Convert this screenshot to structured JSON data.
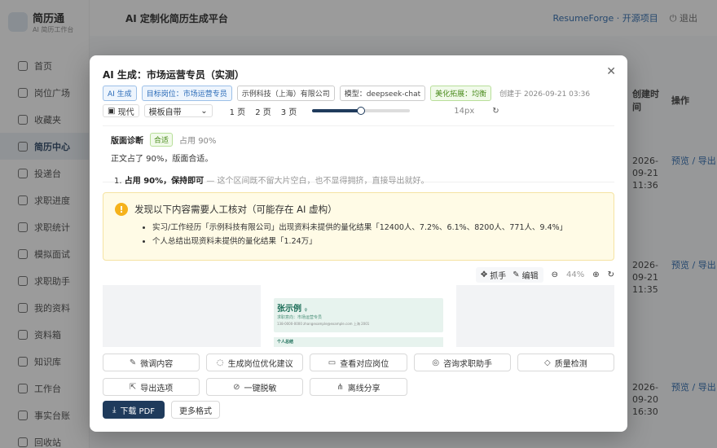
{
  "app": {
    "logo_title": "简历通",
    "logo_sub": "AI 简历工作台",
    "topbar_title": "AI 定制化简历生成平台",
    "repo_link": "ResumeForge · 开源项目",
    "logout": "退出"
  },
  "sidebar": {
    "items": [
      {
        "label": "首页",
        "icon": "home-icon"
      },
      {
        "label": "岗位广场",
        "icon": "briefcase-icon"
      },
      {
        "label": "收藏夹",
        "icon": "star-icon"
      },
      {
        "label": "简历中心",
        "icon": "document-icon",
        "active": true
      },
      {
        "label": "投递台",
        "icon": "send-icon"
      },
      {
        "label": "求职进度",
        "icon": "flag-icon"
      },
      {
        "label": "求职统计",
        "icon": "chart-icon"
      },
      {
        "label": "模拟面试",
        "icon": "mic-icon"
      },
      {
        "label": "求职助手",
        "icon": "chat-icon"
      },
      {
        "label": "我的资料",
        "icon": "user-icon"
      },
      {
        "label": "资料箱",
        "icon": "box-icon"
      },
      {
        "label": "知识库",
        "icon": "book-icon"
      },
      {
        "label": "工作台",
        "icon": "desk-icon"
      },
      {
        "label": "事实台账",
        "icon": "ledger-icon"
      },
      {
        "label": "回收站",
        "icon": "trash-icon"
      }
    ]
  },
  "background_table": {
    "col_time": "创建时间",
    "col_action": "操作",
    "rows": [
      {
        "date": "2026-09-21",
        "time": "11:36",
        "actions": "预览 / 导出"
      },
      {
        "date": "2026-09-21",
        "time": "11:35",
        "actions": "预览 / 导出"
      },
      {
        "date": "2026-09-20",
        "time": "16:30",
        "actions": "预览 / 导出"
      }
    ]
  },
  "modal": {
    "title": "AI 生成：市场运营专员（实测）",
    "close_icon": "close-icon",
    "tags": {
      "ai": "AI 生成",
      "target": "目标岗位：市场运营专员",
      "company": "示例科技（上海）有限公司",
      "model": "模型：deepseek-chat",
      "beautify": "美化拓展：均衡",
      "created": "创建于 2026-09-21 03:36"
    },
    "toolbar": {
      "style_label": "现代",
      "template": "模板自带",
      "pages": [
        "1 页",
        "2 页",
        "3 页"
      ],
      "slider_fraction": 0.5,
      "px": "14px"
    },
    "diagnosis": {
      "label": "版面诊断",
      "status": "合适",
      "usage": "占用 90%",
      "text": "正文占了 90%，版面合适。",
      "item_num": "1.",
      "item_bold": "占用 90%，保持即可",
      "item_rest": " — 这个区间既不留大片空白，也不显得拥挤，直接导出就好。"
    },
    "warning": {
      "icon": "!",
      "title": "发现以下内容需要人工核对（可能存在 AI 虚构）",
      "items": [
        "实习/工作经历「示例科技有限公司」出现资料未提供的量化结果「12400人、7.2%、6.1%、8200人、771人、9.4%」",
        "个人总结出现资料未提供的量化结果「1.24万」"
      ]
    },
    "preview_tools": {
      "grab": "抓手",
      "edit": "编辑",
      "zoom": "44%"
    },
    "paper": {
      "name": "张示例",
      "name_suffix": "♀",
      "sub": "求职意向：市场运营专员",
      "contact": "138-0000-0000    zhangexample@example.com    上海    2001",
      "section": "个人总结"
    },
    "actions": [
      {
        "label": "微调内容",
        "icon": "✎",
        "name": "refine-content-button"
      },
      {
        "label": "生成岗位优化建议",
        "icon": "◌",
        "name": "job-optimize-button"
      },
      {
        "label": "查看对应岗位",
        "icon": "▭",
        "name": "view-job-button"
      },
      {
        "label": "咨询求职助手",
        "icon": "◎",
        "name": "ask-assistant-button"
      },
      {
        "label": "质量检测",
        "icon": "◇",
        "name": "quality-check-button"
      },
      {
        "label": "导出选项",
        "icon": "⇱",
        "name": "export-options-button"
      },
      {
        "label": "一键脱敏",
        "icon": "⊘",
        "name": "desensitize-button"
      },
      {
        "label": "离线分享",
        "icon": "⋔",
        "name": "offline-share-button"
      }
    ],
    "download": "下载 PDF",
    "more_formats": "更多格式"
  }
}
